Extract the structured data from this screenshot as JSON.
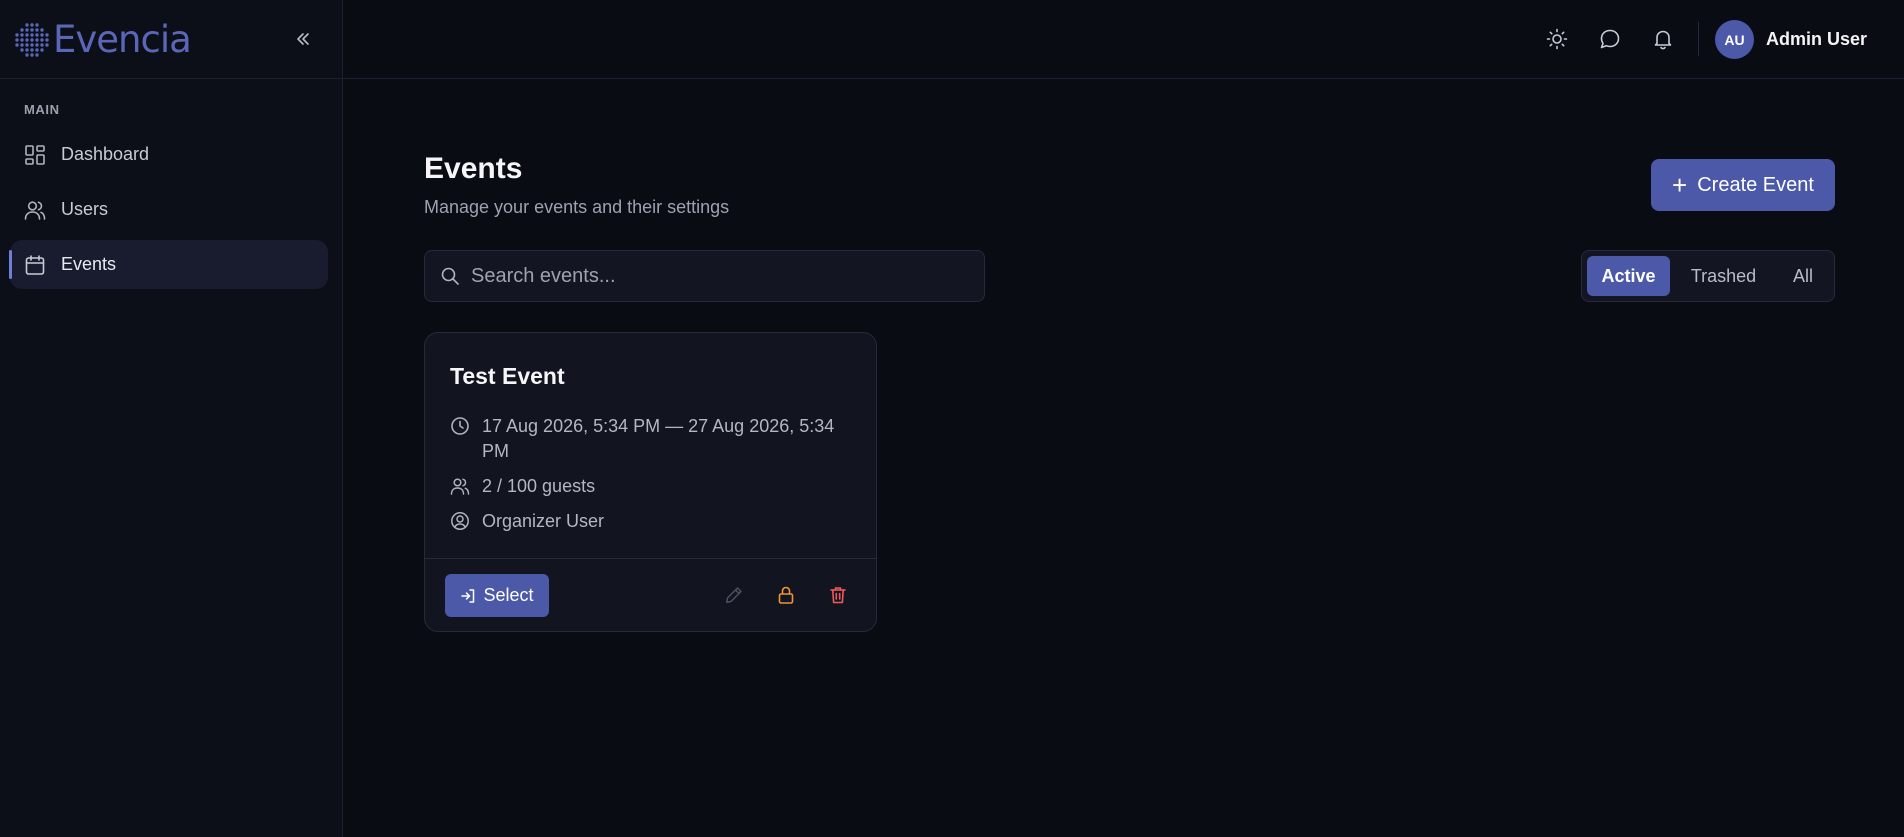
{
  "brand": {
    "name": "Evencia",
    "logo_icon": "dot-grid-logo"
  },
  "sidebar": {
    "section_label": "MAIN",
    "items": [
      {
        "label": "Dashboard",
        "icon": "dashboard-icon",
        "active": false
      },
      {
        "label": "Users",
        "icon": "users-icon",
        "active": false
      },
      {
        "label": "Events",
        "icon": "calendar-icon",
        "active": true
      }
    ]
  },
  "header": {
    "icons": [
      "sun-icon",
      "chat-icon",
      "bell-icon"
    ],
    "user": {
      "initials": "AU",
      "name": "Admin User"
    }
  },
  "main": {
    "title": "Events",
    "subtitle": "Manage your events and their settings",
    "create_label": "Create Event",
    "search": {
      "placeholder": "Search events...",
      "value": ""
    },
    "filters": [
      {
        "label": "Active",
        "active": true
      },
      {
        "label": "Trashed",
        "active": false
      },
      {
        "label": "All",
        "active": false
      }
    ]
  },
  "events": [
    {
      "title": "Test Event",
      "date_range": "17 Aug 2026, 5:34 PM — 27 Aug 2026, 5:34 PM",
      "guests": "2 / 100 guests",
      "organizer": "Organizer User",
      "select_label": "Select"
    }
  ],
  "colors": {
    "accent": "#4c58a8",
    "background": "#0a0c13",
    "lock": "#f0923a",
    "delete": "#ef5b5b"
  }
}
